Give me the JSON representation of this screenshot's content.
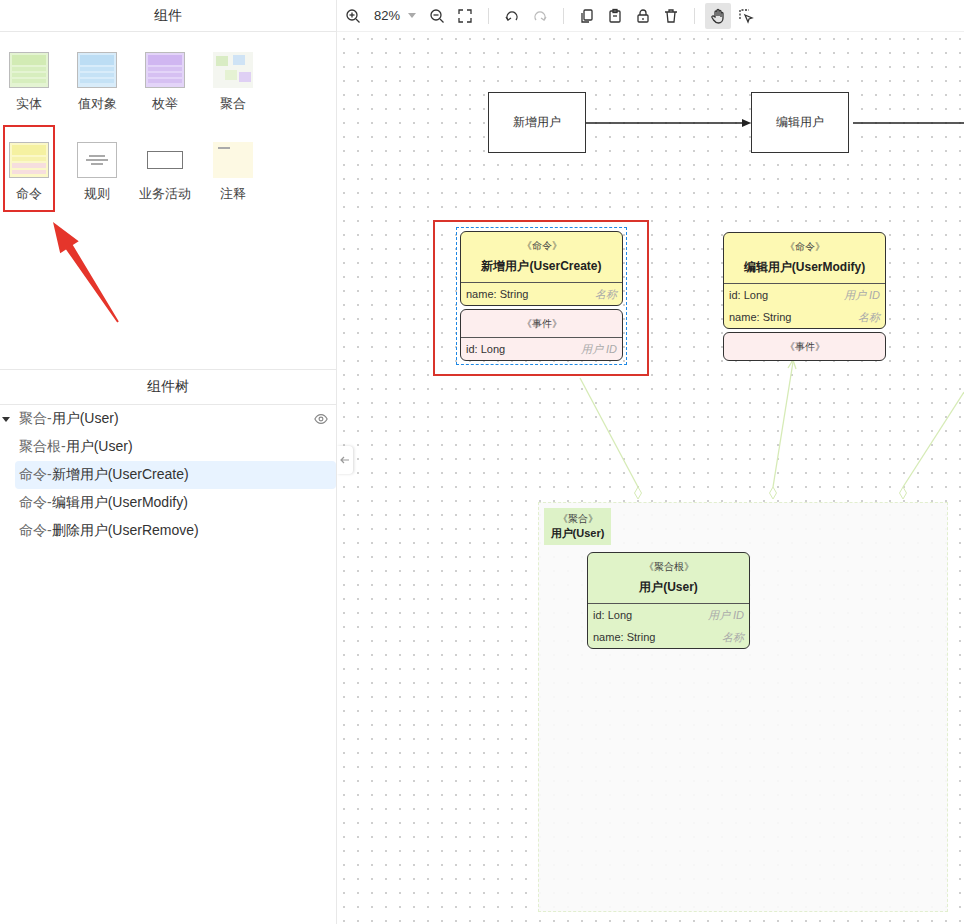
{
  "sidebar": {
    "palette_title": "组件",
    "palette": [
      {
        "label": "实体",
        "kind": "entity",
        "highlighted": false
      },
      {
        "label": "值对象",
        "kind": "value-object",
        "highlighted": false
      },
      {
        "label": "枚举",
        "kind": "enum",
        "highlighted": false
      },
      {
        "label": "聚合",
        "kind": "aggregate",
        "highlighted": false
      },
      {
        "label": "命令",
        "kind": "command",
        "highlighted": true
      },
      {
        "label": "规则",
        "kind": "rule",
        "highlighted": false
      },
      {
        "label": "业务活动",
        "kind": "activity",
        "highlighted": false
      },
      {
        "label": "注释",
        "kind": "note",
        "highlighted": false
      }
    ],
    "tree_title": "组件树",
    "tree": [
      {
        "prefix": "聚合-",
        "name": "用户(User)",
        "level": 0,
        "expanded": true,
        "selected": false,
        "eye_shown": true
      },
      {
        "prefix": "聚合根-",
        "name": "用户(User)",
        "level": 1,
        "expanded": false,
        "selected": false,
        "eye_shown": false
      },
      {
        "prefix": "命令-",
        "name": "新增用户(UserCreate)",
        "level": 1,
        "expanded": false,
        "selected": true,
        "eye_shown": false
      },
      {
        "prefix": "命令-",
        "name": "编辑用户(UserModify)",
        "level": 1,
        "expanded": false,
        "selected": false,
        "eye_shown": false
      },
      {
        "prefix": "命令-",
        "name": "删除用户(UserRemove)",
        "level": 1,
        "expanded": false,
        "selected": false,
        "eye_shown": false
      }
    ]
  },
  "toolbar": {
    "groups": [
      [
        {
          "kind": "zoom-in",
          "disabled": false,
          "selected": false
        },
        {
          "kind": "zoom-level",
          "text": "82%",
          "disabled": false,
          "selected": false
        },
        {
          "kind": "zoom-out",
          "disabled": false,
          "selected": false
        },
        {
          "kind": "fit",
          "disabled": false,
          "selected": false
        }
      ],
      [
        {
          "kind": "undo",
          "disabled": false,
          "selected": false
        },
        {
          "kind": "redo",
          "disabled": true,
          "selected": false
        }
      ],
      [
        {
          "kind": "copy",
          "disabled": false,
          "selected": false
        },
        {
          "kind": "paste",
          "disabled": false,
          "selected": false
        },
        {
          "kind": "lock",
          "disabled": false,
          "selected": false
        },
        {
          "kind": "delete",
          "disabled": false,
          "selected": false
        }
      ],
      [
        {
          "kind": "hand",
          "disabled": false,
          "selected": true
        },
        {
          "kind": "select",
          "disabled": false,
          "selected": false
        }
      ]
    ]
  },
  "canvas": {
    "flow": [
      "新增用户",
      "编辑用户"
    ],
    "commands": [
      {
        "stereotype": "《命令》",
        "title": "新增用户(UserCreate)",
        "fields": [
          {
            "name": "name: String",
            "note": "名称"
          }
        ],
        "event": {
          "stereotype": "《事件》",
          "fields": [
            {
              "name": "id: Long",
              "note": "用户 ID"
            }
          ]
        },
        "selected": true,
        "highlighted": true
      },
      {
        "stereotype": "《命令》",
        "title": "编辑用户(UserModify)",
        "fields": [
          {
            "name": "id: Long",
            "note": "用户 ID"
          },
          {
            "name": "name: String",
            "note": "名称"
          }
        ],
        "event": {
          "stereotype": "《事件》",
          "fields": []
        },
        "selected": false,
        "highlighted": false
      }
    ],
    "aggregate": {
      "stereotype": "《聚合》",
      "title": "用户(User)",
      "root": {
        "stereotype": "《聚合根》",
        "title": "用户(User)",
        "fields": [
          {
            "name": "id: Long",
            "note": "用户 ID"
          },
          {
            "name": "name: String",
            "note": "名称"
          }
        ]
      }
    }
  }
}
